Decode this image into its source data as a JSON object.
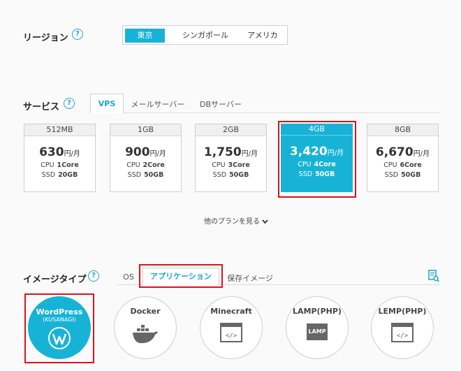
{
  "region": {
    "label": "リージョン",
    "help": "?",
    "options": [
      "東京",
      "シンガポール",
      "アメリカ"
    ],
    "selected": "東京"
  },
  "service": {
    "label": "サービス",
    "help": "?",
    "tabs": [
      "VPS",
      "メールサーバー",
      "DBサーバー"
    ],
    "active_tab": "VPS"
  },
  "plans": [
    {
      "name": "512MB",
      "price": "630",
      "unit": "円/月",
      "cpu_label": "CPU",
      "cpu": "1Core",
      "ssd_label": "SSD",
      "ssd": "20GB"
    },
    {
      "name": "1GB",
      "price": "900",
      "unit": "円/月",
      "cpu_label": "CPU",
      "cpu": "2Core",
      "ssd_label": "SSD",
      "ssd": "50GB"
    },
    {
      "name": "2GB",
      "price": "1,750",
      "unit": "円/月",
      "cpu_label": "CPU",
      "cpu": "3Core",
      "ssd_label": "SSD",
      "ssd": "50GB"
    },
    {
      "name": "4GB",
      "price": "3,420",
      "unit": "円/月",
      "cpu_label": "CPU",
      "cpu": "4Core",
      "ssd_label": "SSD",
      "ssd": "50GB",
      "selected": true
    },
    {
      "name": "8GB",
      "price": "6,670",
      "unit": "円/月",
      "cpu_label": "CPU",
      "cpu": "6Core",
      "ssd_label": "SSD",
      "ssd": "50GB"
    }
  ],
  "more_plans": "他のプランを見る",
  "image_type": {
    "label": "イメージタイプ",
    "help": "?",
    "tabs": [
      "OS",
      "アプリケーション",
      "保存イメージ"
    ],
    "active_tab": "アプリケーション"
  },
  "apps": [
    {
      "name": "WordPress",
      "sub": "(KUSANAGI)",
      "icon": "wordpress-logo",
      "selected": true
    },
    {
      "name": "Docker",
      "icon": "docker-whale-icon"
    },
    {
      "name": "Minecraft",
      "icon": "code-window-icon"
    },
    {
      "name": "LAMP(PHP)",
      "icon": "lamp-badge",
      "badge": "LAMP"
    },
    {
      "name": "LEMP(PHP)",
      "icon": "code-window-icon"
    }
  ],
  "colors": {
    "accent": "#17b3d6",
    "highlight": "#d8141b"
  }
}
